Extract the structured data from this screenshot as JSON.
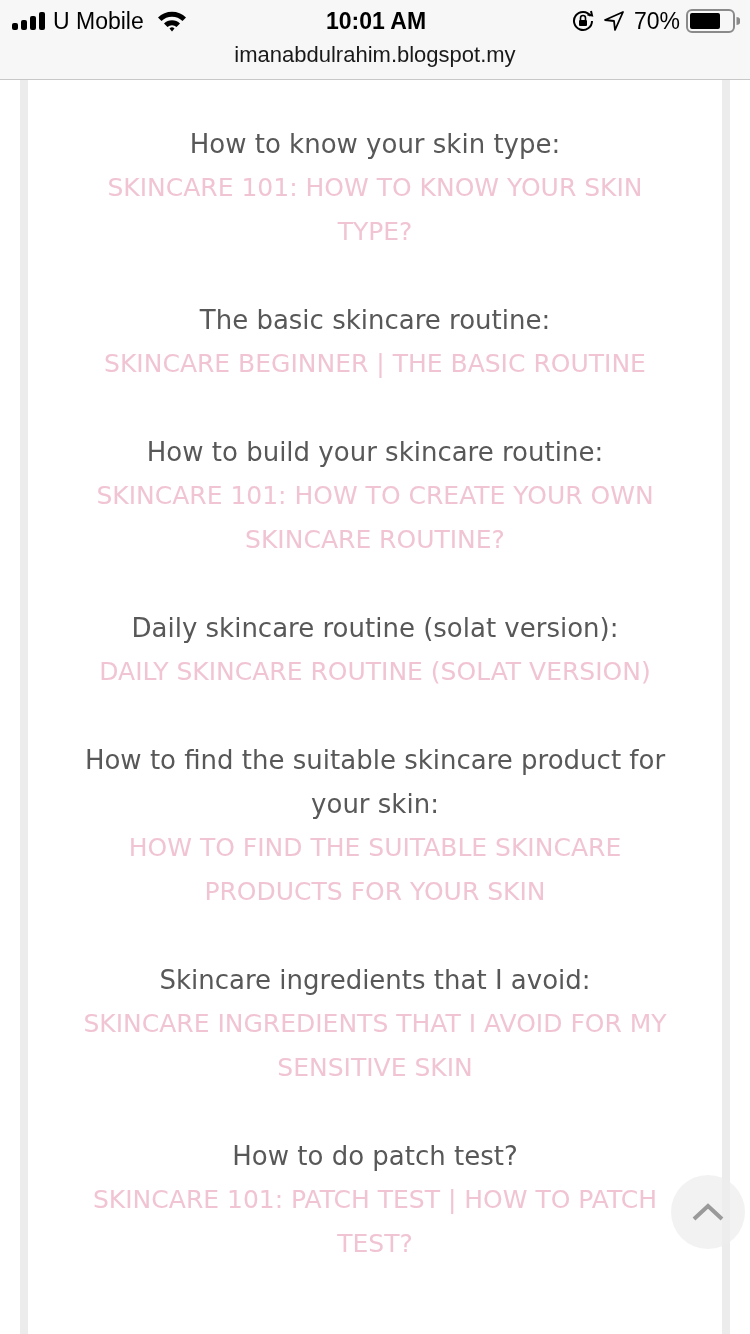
{
  "status_bar": {
    "carrier": "U Mobile",
    "time": "10:01 AM",
    "battery": "70%"
  },
  "address_bar": {
    "url": "imanabdulrahim.blogspot.my"
  },
  "sections": [
    {
      "label": "How to know your skin type:",
      "link": "SKINCARE 101: HOW TO KNOW YOUR SKIN TYPE?"
    },
    {
      "label": "The basic skincare routine:",
      "link": "SKINCARE BEGINNER | THE BASIC ROUTINE"
    },
    {
      "label": "How to build your skincare routine:",
      "link": "SKINCARE 101: HOW TO CREATE YOUR OWN SKINCARE ROUTINE?"
    },
    {
      "label": "Daily skincare routine (solat version):",
      "link": "DAILY SKINCARE ROUTINE (SOLAT VERSION)"
    },
    {
      "label": "How to find the suitable skincare product for your skin:",
      "link": "HOW TO FIND THE SUITABLE SKINCARE PRODUCTS FOR YOUR SKIN"
    },
    {
      "label": "Skincare ingredients that I avoid:",
      "link": "SKINCARE INGREDIENTS THAT I AVOID FOR MY SENSITIVE SKIN"
    },
    {
      "label": "How to do patch test?",
      "link": "SKINCARE 101: PATCH TEST | HOW TO PATCH TEST?"
    }
  ]
}
